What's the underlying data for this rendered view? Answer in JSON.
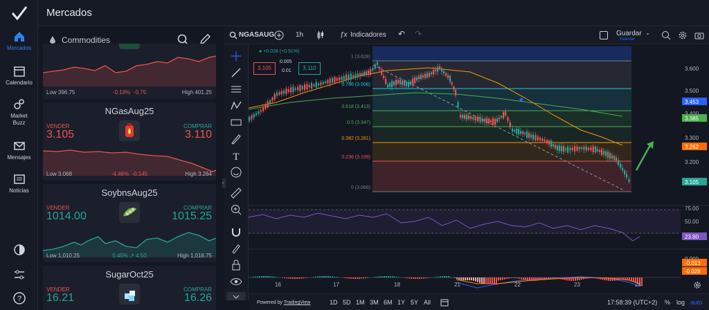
{
  "app": {
    "title": "Mercados"
  },
  "nav": {
    "items": [
      {
        "label": "Mercados",
        "icon": "home-icon"
      },
      {
        "label": "Calendario",
        "icon": "calendar-icon"
      },
      {
        "label": "Market Buzz",
        "icon": "buzz-icon"
      },
      {
        "label": "Mensajes",
        "icon": "mail-icon"
      },
      {
        "label": "Noticias",
        "icon": "news-icon"
      }
    ]
  },
  "watchlist": {
    "category": "Commodities",
    "cards": [
      {
        "name": "",
        "sell_label": "",
        "buy_label": "",
        "sell": "",
        "buy": "",
        "low": "Low 396.75",
        "change": "-0.19%",
        "change_abs": "-0.75",
        "high": "High 401.25",
        "dir": "down"
      },
      {
        "name": "NGasAug25",
        "sell_label": "VENDER",
        "buy_label": "COMPRAR",
        "sell": "3.105",
        "buy": "3.110",
        "low": "Low 3.068",
        "change": "-4.46%",
        "change_abs": "-0.145",
        "high": "High 3.264",
        "dir": "down"
      },
      {
        "name": "SoybnsAug25",
        "sell_label": "VENDER",
        "buy_label": "COMPRAR",
        "sell": "1014.00",
        "buy": "1015.25",
        "low": "Low 1,010.25",
        "change": "0.45%",
        "change_abs": "4.50",
        "high": "High 1,018.75",
        "dir": "up"
      },
      {
        "name": "SugarOct25",
        "sell_label": "VENDER",
        "buy_label": "COMPRAR",
        "sell": "16.21",
        "buy": "16.26",
        "low": "",
        "change": "",
        "change_abs": "",
        "high": "",
        "dir": "up"
      }
    ]
  },
  "chart": {
    "symbol": "NGASAUG",
    "interval": "1h",
    "indicators_label": "Indicadores",
    "save_label": "Guardar",
    "save_sub": "Guardar",
    "change_text": "+0.028 (+0.91%)",
    "sell_box": "3.105",
    "spread_top": "0.005",
    "spread_bottom": "0.01",
    "buy_box": "3.110",
    "fib_levels": [
      {
        "label": "1 (3.628)",
        "color": "#787b86"
      },
      {
        "label": "0.786 (3.508)",
        "color": "#26c6da"
      },
      {
        "label": "0.618 (3.413)",
        "color": "#4caf50"
      },
      {
        "label": "0.5 (3.347)",
        "color": "#4caf50"
      },
      {
        "label": "0.382 (3.281)",
        "color": "#ff9800"
      },
      {
        "label": "0.236 (3.199)",
        "color": "#ef5350"
      },
      {
        "label": "0 (3.066)",
        "color": "#787b86"
      }
    ],
    "price_axis": [
      "3.600",
      "3.500",
      "3.400",
      "3.300",
      "3.200"
    ],
    "price_tags": [
      {
        "value": "3.453",
        "color": "#2962ff"
      },
      {
        "value": "3.385",
        "color": "#4caf50"
      },
      {
        "value": "3.262",
        "color": "#ff6d00"
      },
      {
        "value": "3.105",
        "color": "#26a69a"
      }
    ],
    "rsi_axis": [
      "75.00",
      "50.00"
    ],
    "rsi_tag": "23.80",
    "macd_axis": [
      "0.000"
    ],
    "macd_tags": [
      "-0.013",
      "-0.028"
    ],
    "x_labels": [
      "16",
      "17",
      "18",
      "21",
      "22",
      "23",
      "24"
    ],
    "powered_by": "Powered by",
    "powered_link": "TradingView",
    "ranges": [
      "1D",
      "5D",
      "1M",
      "3M",
      "6M",
      "1Y",
      "5Y",
      "All"
    ],
    "clock": "17:58:39 (UTC+2)",
    "scale_opts": [
      "%",
      "log",
      "auto"
    ]
  },
  "colors": {
    "accent": "#2f80ed",
    "up": "#26a69a",
    "down": "#ef5350",
    "bg": "#131722"
  }
}
